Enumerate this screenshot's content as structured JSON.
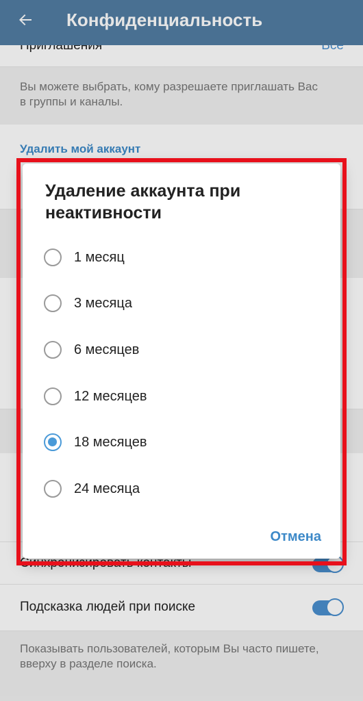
{
  "app_bar": {
    "title": "Конфиденциальность",
    "back_icon": "arrow-left-icon"
  },
  "background": {
    "invites_row": {
      "label": "Приглашения",
      "value": "Все"
    },
    "invites_hint": "Вы можете выбрать, кому разрешаете приглашать Вас в группы и каналы.",
    "delete_account_header": "Удалить мой аккаунт",
    "sync_contacts_row": {
      "label": "Синхронизировать контакты",
      "enabled": true
    },
    "suggest_people_row": {
      "label": "Подсказка людей при поиске",
      "enabled": true
    },
    "suggest_hint": "Показывать пользователей, которым Вы часто пишете, вверху в разделе поиска."
  },
  "dialog": {
    "title": "Удаление аккаунта при неактивности",
    "options": [
      {
        "label": "1 месяц",
        "checked": false
      },
      {
        "label": "3 месяца",
        "checked": false
      },
      {
        "label": "6 месяцев",
        "checked": false
      },
      {
        "label": "12 месяцев",
        "checked": false
      },
      {
        "label": "18 месяцев",
        "checked": true
      },
      {
        "label": "24 месяца",
        "checked": false
      }
    ],
    "cancel_label": "Отмена"
  },
  "colors": {
    "app_bar": "#527da3",
    "accent": "#4a9ad8",
    "highlight_frame": "#e8101b"
  }
}
